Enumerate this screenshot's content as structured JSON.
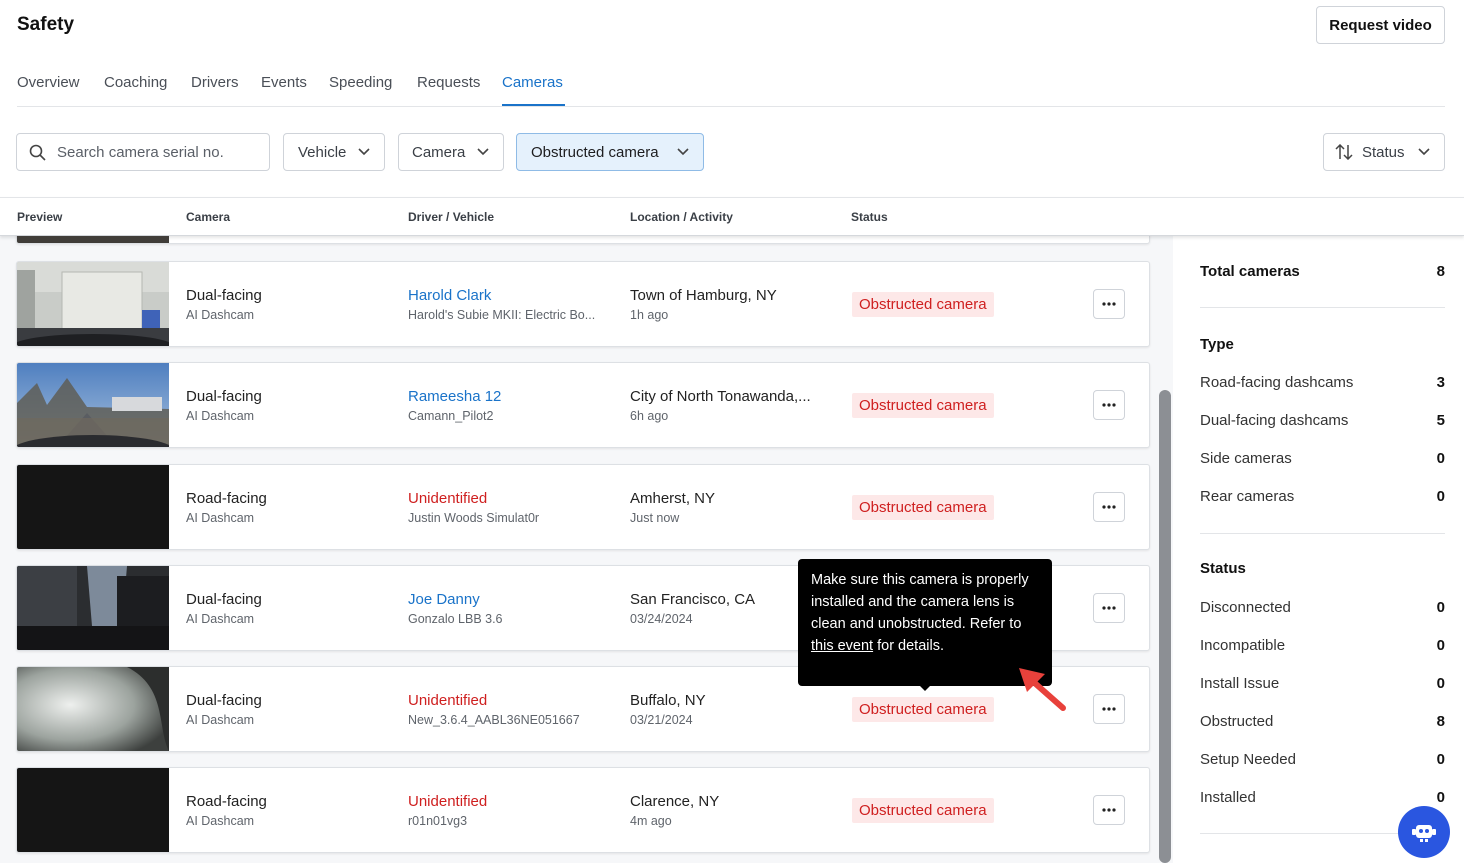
{
  "header": {
    "title": "Safety",
    "request_video": "Request video"
  },
  "tabs": [
    "Overview",
    "Coaching",
    "Drivers",
    "Events",
    "Speeding",
    "Requests",
    "Cameras"
  ],
  "active_tab": "Cameras",
  "filters": {
    "search_placeholder": "Search camera serial no.",
    "vehicle": "Vehicle",
    "camera": "Camera",
    "obstructed": "Obstructed camera",
    "sort": "Status"
  },
  "columns": [
    "Preview",
    "Camera",
    "Driver / Vehicle",
    "Location / Activity",
    "Status"
  ],
  "rows": [
    {
      "camera": "Dual-facing",
      "model": "AI Dashcam",
      "driver": "Harold Clark",
      "driver_style": "link",
      "vehicle": "Harold's Subie MKII: Electric Bo...",
      "location": "Town of Hamburg, NY",
      "activity": "1h ago",
      "status": "Obstructed camera"
    },
    {
      "camera": "Dual-facing",
      "model": "AI Dashcam",
      "driver": "Rameesha 12",
      "driver_style": "link",
      "vehicle": "Camann_Pilot2",
      "location": "City of North Tonawanda,...",
      "activity": "6h ago",
      "status": "Obstructed camera"
    },
    {
      "camera": "Road-facing",
      "model": "AI Dashcam",
      "driver": "Unidentified",
      "driver_style": "unid",
      "vehicle": "Justin Woods Simulat0r",
      "location": "Amherst, NY",
      "activity": "Just now",
      "status": "Obstructed camera"
    },
    {
      "camera": "Dual-facing",
      "model": "AI Dashcam",
      "driver": "Joe Danny",
      "driver_style": "link",
      "vehicle": "Gonzalo LBB 3.6",
      "location": "San Francisco, CA",
      "activity": "03/24/2024",
      "status": ""
    },
    {
      "camera": "Dual-facing",
      "model": "AI Dashcam",
      "driver": "Unidentified",
      "driver_style": "unid",
      "vehicle": "New_3.6.4_AABL36NE051667",
      "location": "Buffalo, NY",
      "activity": "03/21/2024",
      "status": "Obstructed camera"
    },
    {
      "camera": "Road-facing",
      "model": "AI Dashcam",
      "driver": "Unidentified",
      "driver_style": "unid",
      "vehicle": "r01n01vg3",
      "location": "Clarence, NY",
      "activity": "4m ago",
      "status": "Obstructed camera"
    }
  ],
  "tooltip": {
    "text_before": "Make sure this camera is properly installed and the camera lens is clean and unobstructed. Refer to ",
    "link": "this event",
    "text_after": " for details."
  },
  "summary": {
    "total_label": "Total cameras",
    "total_value": "8",
    "type_heading": "Type",
    "types": [
      {
        "label": "Road-facing dashcams",
        "value": "3"
      },
      {
        "label": "Dual-facing dashcams",
        "value": "5"
      },
      {
        "label": "Side cameras",
        "value": "0"
      },
      {
        "label": "Rear cameras",
        "value": "0"
      }
    ],
    "status_heading": "Status",
    "statuses": [
      {
        "label": "Disconnected",
        "value": "0"
      },
      {
        "label": "Incompatible",
        "value": "0"
      },
      {
        "label": "Install Issue",
        "value": "0"
      },
      {
        "label": "Obstructed",
        "value": "8"
      },
      {
        "label": "Setup Needed",
        "value": "0"
      },
      {
        "label": "Installed",
        "value": "0"
      }
    ]
  },
  "colors": {
    "accent": "#1a73c9",
    "danger": "#cf2020",
    "badge_bg": "#fde8e8",
    "chat": "#2a56e0"
  },
  "icons": [
    "search-icon",
    "chevron-down-icon",
    "sort-arrows-icon",
    "more-icon",
    "chat-bot-icon"
  ]
}
